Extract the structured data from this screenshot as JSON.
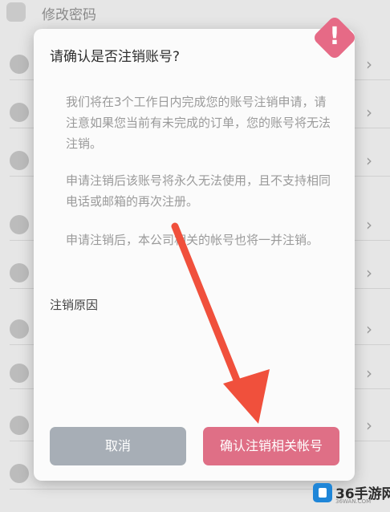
{
  "background": {
    "title": "修改密码"
  },
  "dialog": {
    "title": "请确认是否注销账号?",
    "warning_icon": "exclamation-icon",
    "warning_mark": "!",
    "paragraphs": [
      "我们将在3个工作日内完成您的账号注销申请，请注意如果您当前有未完成的订单，您的账号将无法注销。",
      "申请注销后该账号将永久无法使用，且不支持相同电话或邮箱的再次注册。",
      "申请注销后，本公司相关的帐号也将一并注销。"
    ],
    "reason_label": "注销原因",
    "cancel_label": "取消",
    "confirm_label": "确认注销相关帐号"
  },
  "watermark": {
    "text": "36手游网",
    "url": "36WAN.COM"
  },
  "colors": {
    "accent": "#df6f86",
    "cancel": "#a7aeb6",
    "arrow": "#f0503c"
  }
}
